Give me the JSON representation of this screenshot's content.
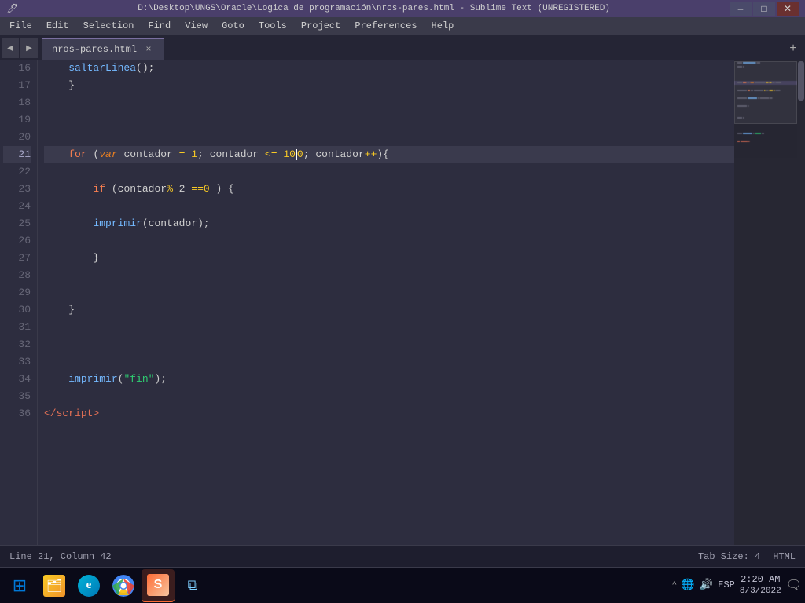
{
  "titlebar": {
    "title": "D:\\Desktop\\UNGS\\Oracle\\Logica de programación\\nros-pares.html - Sublime Text (UNREGISTERED)",
    "min_label": "–",
    "max_label": "□",
    "close_label": "✕"
  },
  "menubar": {
    "items": [
      "File",
      "Edit",
      "Selection",
      "Find",
      "View",
      "Goto",
      "Tools",
      "Project",
      "Preferences",
      "Help"
    ]
  },
  "tabbar": {
    "tab_name": "nros-pares.html",
    "close_label": "×",
    "add_label": "+"
  },
  "editor": {
    "lines": [
      {
        "num": "16",
        "content": [
          {
            "type": "indent2",
            "text": "    "
          },
          {
            "type": "fn",
            "text": "saltarLinea"
          },
          {
            "type": "punct",
            "text": "();"
          }
        ],
        "active": false
      },
      {
        "num": "17",
        "content": [
          {
            "type": "indent1",
            "text": "    "
          },
          {
            "type": "punct",
            "text": "}"
          }
        ],
        "active": false
      },
      {
        "num": "18",
        "content": [],
        "active": false
      },
      {
        "num": "19",
        "content": [],
        "active": false
      },
      {
        "num": "20",
        "content": [],
        "active": false
      },
      {
        "num": "21",
        "content": [
          {
            "type": "indent1",
            "text": "    "
          },
          {
            "type": "kw-for",
            "text": "for"
          },
          {
            "type": "punct",
            "text": " ("
          },
          {
            "type": "kw-var",
            "text": "var"
          },
          {
            "type": "ident",
            "text": " contador"
          },
          {
            "type": "op",
            "text": " ="
          },
          {
            "type": "num",
            "text": " 1"
          },
          {
            "type": "punct",
            "text": "; "
          },
          {
            "type": "ident",
            "text": "contador"
          },
          {
            "type": "op",
            "text": " <="
          },
          {
            "type": "num",
            "text": " 10"
          },
          {
            "type": "cursor",
            "text": ""
          },
          {
            "type": "num",
            "text": "0"
          },
          {
            "type": "punct",
            "text": ";"
          },
          {
            "type": "ident",
            "text": " contador"
          },
          {
            "type": "op",
            "text": "++"
          },
          {
            "type": "punct",
            "text": "){"
          }
        ],
        "active": true
      },
      {
        "num": "22",
        "content": [],
        "active": false
      },
      {
        "num": "23",
        "content": [
          {
            "type": "indent2",
            "text": "        "
          },
          {
            "type": "kw-if",
            "text": "if"
          },
          {
            "type": "punct",
            "text": " ("
          },
          {
            "type": "ident",
            "text": "contador"
          },
          {
            "type": "op",
            "text": "%"
          },
          {
            "type": "ident",
            "text": " 2"
          },
          {
            "type": "op",
            "text": " =="
          },
          {
            "type": "num",
            "text": "0"
          },
          {
            "type": "punct",
            "text": " ) {"
          }
        ],
        "active": false
      },
      {
        "num": "24",
        "content": [],
        "active": false
      },
      {
        "num": "25",
        "content": [
          {
            "type": "indent2",
            "text": "        "
          },
          {
            "type": "fn",
            "text": "imprimir"
          },
          {
            "type": "punct",
            "text": "("
          },
          {
            "type": "ident",
            "text": "contador"
          },
          {
            "type": "punct",
            "text": ");"
          }
        ],
        "active": false
      },
      {
        "num": "26",
        "content": [],
        "active": false
      },
      {
        "num": "27",
        "content": [
          {
            "type": "indent2",
            "text": "        "
          },
          {
            "type": "punct",
            "text": "}"
          }
        ],
        "active": false
      },
      {
        "num": "28",
        "content": [],
        "active": false
      },
      {
        "num": "29",
        "content": [],
        "active": false
      },
      {
        "num": "30",
        "content": [
          {
            "type": "indent1",
            "text": "    "
          },
          {
            "type": "punct",
            "text": "}"
          }
        ],
        "active": false
      },
      {
        "num": "31",
        "content": [],
        "active": false
      },
      {
        "num": "32",
        "content": [],
        "active": false
      },
      {
        "num": "33",
        "content": [],
        "active": false
      },
      {
        "num": "34",
        "content": [
          {
            "type": "indent1",
            "text": "    "
          },
          {
            "type": "fn",
            "text": "imprimir"
          },
          {
            "type": "punct",
            "text": "("
          },
          {
            "type": "str",
            "text": "\"fin\""
          },
          {
            "type": "punct",
            "text": ");"
          }
        ],
        "active": false
      },
      {
        "num": "35",
        "content": [],
        "active": false
      },
      {
        "num": "36",
        "content": [
          {
            "type": "tag",
            "text": "</"
          },
          {
            "type": "tag",
            "text": "script"
          },
          {
            "type": "tag",
            "text": ">"
          }
        ],
        "active": false
      }
    ]
  },
  "statusbar": {
    "left": "Line 21, Column 42",
    "right_tab": "Tab Size: 4",
    "right_lang": "HTML"
  },
  "taskbar": {
    "start_icon": "⊞",
    "items": [
      {
        "name": "windows-start",
        "icon_text": "⊞",
        "type": "start"
      },
      {
        "name": "file-manager",
        "icon_text": "🗂",
        "type": "file"
      },
      {
        "name": "edge",
        "icon_text": "e",
        "type": "edge"
      },
      {
        "name": "chrome",
        "icon_text": "●",
        "type": "chrome"
      },
      {
        "name": "sublime",
        "icon_text": "S",
        "type": "sublime"
      },
      {
        "name": "task-view",
        "icon_text": "⧉",
        "type": "taskview"
      }
    ],
    "sys": {
      "chevron": "^",
      "network": "🌐",
      "volume": "🔊",
      "lang": "ESP",
      "time": "2:20 AM",
      "date": "8/3/2022",
      "notification": "🗨"
    }
  }
}
